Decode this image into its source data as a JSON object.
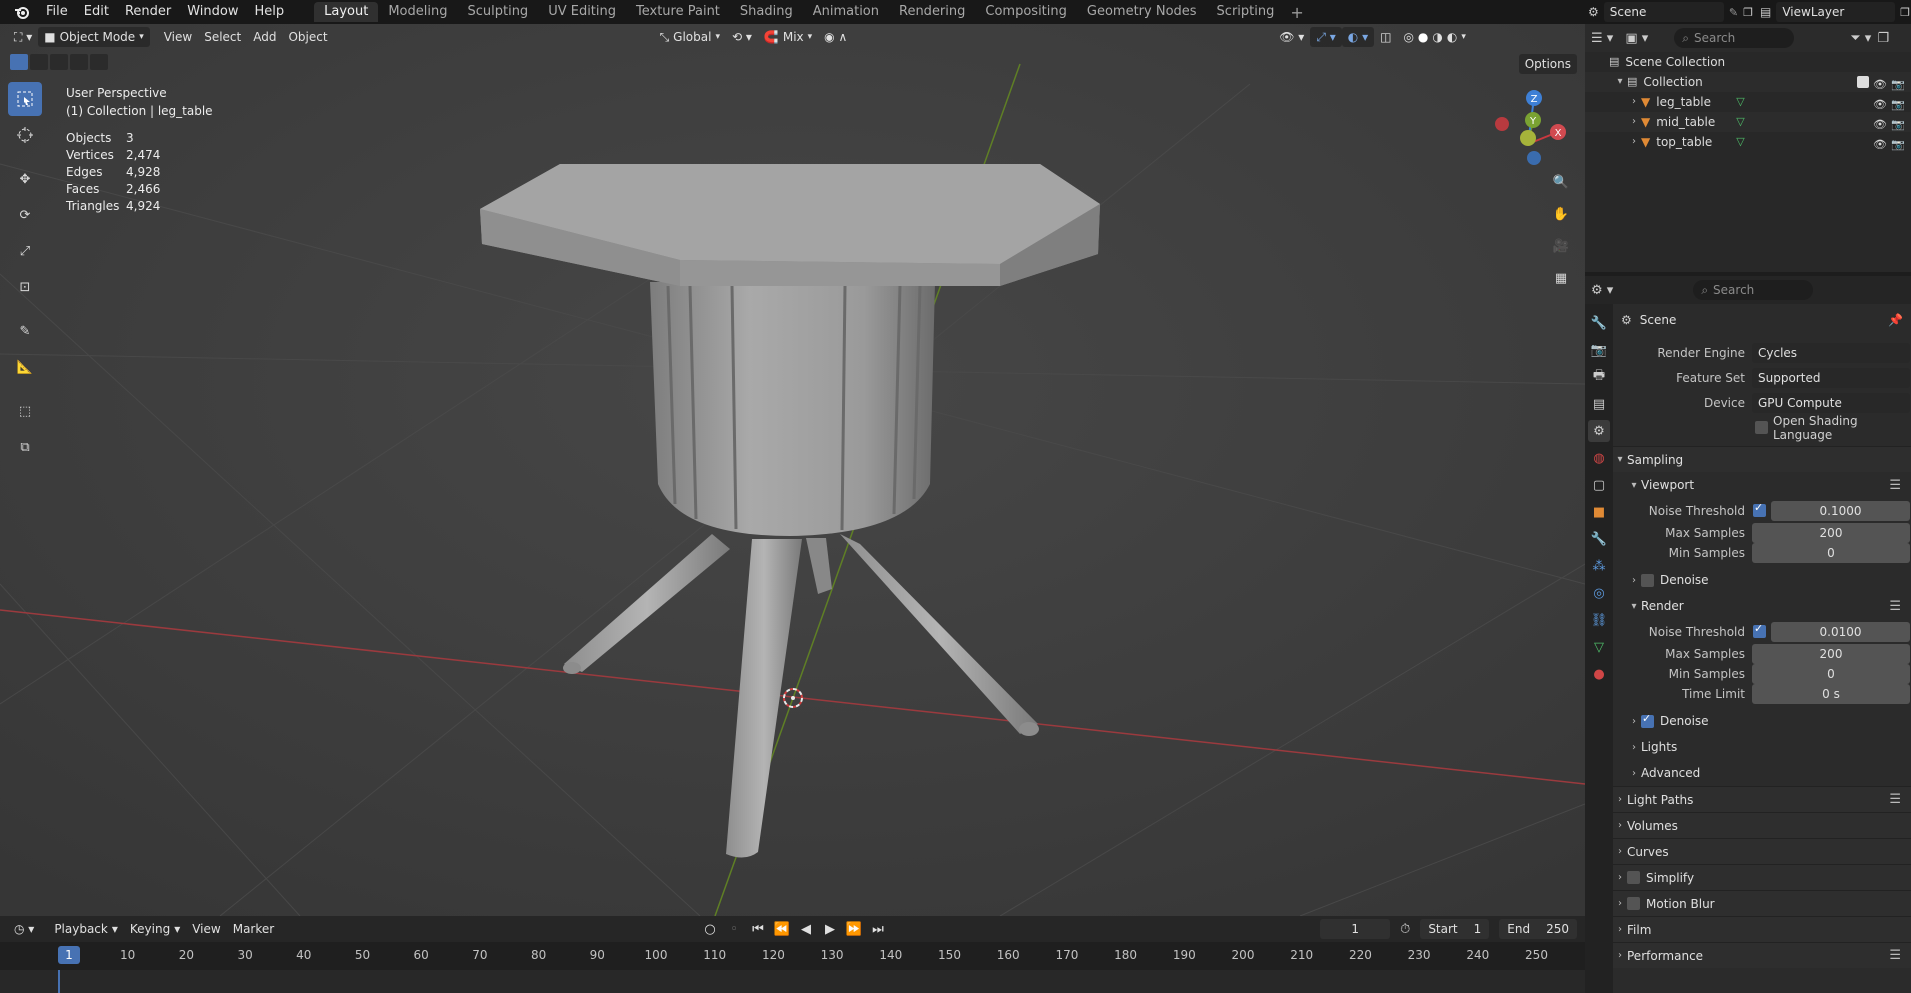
{
  "menu": {
    "items": [
      "File",
      "Edit",
      "Render",
      "Window",
      "Help"
    ]
  },
  "workspaces": {
    "tabs": [
      "Layout",
      "Modeling",
      "Sculpting",
      "UV Editing",
      "Texture Paint",
      "Shading",
      "Animation",
      "Rendering",
      "Compositing",
      "Geometry Nodes",
      "Scripting"
    ],
    "active": "Layout",
    "add_label": "+"
  },
  "scene_selector": {
    "value": "Scene"
  },
  "viewlayer_selector": {
    "value": "ViewLayer"
  },
  "viewport_header": {
    "mode": "Object Mode",
    "menus": [
      "View",
      "Select",
      "Add",
      "Object"
    ],
    "orientation": "Global",
    "snap_mix": "Mix",
    "options": "Options"
  },
  "viewport_overlay": {
    "perspective": "User Perspective",
    "collection_path": "(1) Collection | leg_table",
    "stats": [
      {
        "k": "Objects",
        "v": "3"
      },
      {
        "k": "Vertices",
        "v": "2,474"
      },
      {
        "k": "Edges",
        "v": "4,928"
      },
      {
        "k": "Faces",
        "v": "2,466"
      },
      {
        "k": "Triangles",
        "v": "4,924"
      }
    ]
  },
  "gizmo": {
    "x": "X",
    "y": "Y",
    "z": "Z"
  },
  "outliner": {
    "search_placeholder": "Search",
    "root": "Scene Collection",
    "collection": "Collection",
    "objects": [
      "leg_table",
      "mid_table",
      "top_table"
    ]
  },
  "properties": {
    "search_placeholder": "Search",
    "context": "Scene",
    "render_engine_label": "Render Engine",
    "render_engine": "Cycles",
    "feature_set_label": "Feature Set",
    "feature_set": "Supported",
    "device_label": "Device",
    "device": "GPU Compute",
    "osl_label": "Open Shading Language",
    "sampling": "Sampling",
    "viewport": "Viewport",
    "render": "Render",
    "noise_threshold_label": "Noise Threshold",
    "max_samples_label": "Max Samples",
    "min_samples_label": "Min Samples",
    "time_limit_label": "Time Limit",
    "denoise_label": "Denoise",
    "viewport_noise": "0.1000",
    "viewport_max": "200",
    "viewport_min": "0",
    "render_noise": "0.0100",
    "render_max": "200",
    "render_min": "0",
    "time_limit": "0 s",
    "lights": "Lights",
    "advanced": "Advanced",
    "panels": [
      "Light Paths",
      "Volumes",
      "Curves",
      "Simplify",
      "Motion Blur",
      "Film",
      "Performance"
    ]
  },
  "timeline": {
    "menus": [
      "Playback",
      "Keying",
      "View",
      "Marker"
    ],
    "current_frame": "1",
    "start_label": "Start",
    "start": "1",
    "end_label": "End",
    "end": "250",
    "frames": [
      "1",
      "10",
      "20",
      "30",
      "40",
      "50",
      "60",
      "70",
      "80",
      "90",
      "100",
      "110",
      "120",
      "130",
      "140",
      "150",
      "160",
      "170",
      "180",
      "190",
      "200",
      "210",
      "220",
      "230",
      "240",
      "250"
    ]
  },
  "colors": {
    "accent": "#4772b3",
    "x_axis": "#c8383f",
    "y_axis": "#6e9a26",
    "z_axis": "#3e80d6"
  }
}
